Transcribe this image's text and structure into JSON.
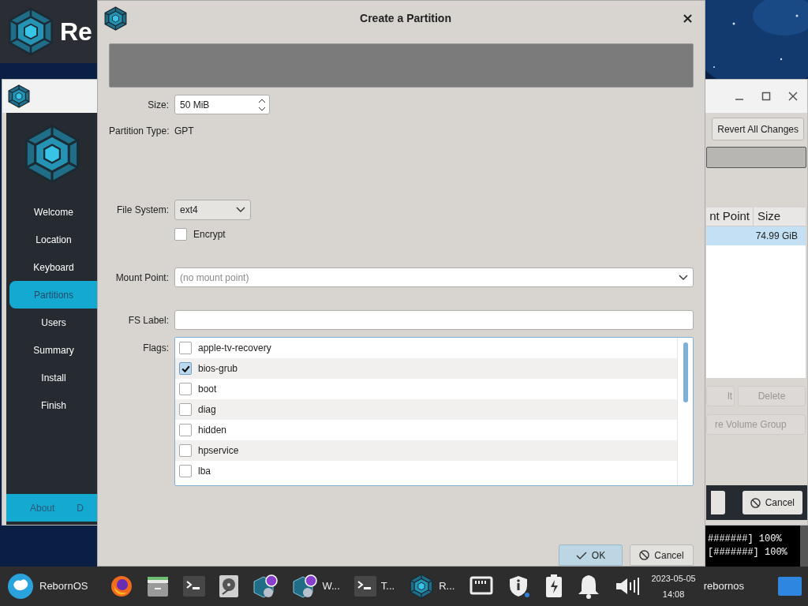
{
  "banner": {
    "text": "Re"
  },
  "installer": {
    "sidebar": [
      {
        "label": "Welcome",
        "selected": false
      },
      {
        "label": "Location",
        "selected": false
      },
      {
        "label": "Keyboard",
        "selected": false
      },
      {
        "label": "Partitions",
        "selected": true
      },
      {
        "label": "Users",
        "selected": false
      },
      {
        "label": "Summary",
        "selected": false
      },
      {
        "label": "Install",
        "selected": false
      },
      {
        "label": "Finish",
        "selected": false
      }
    ],
    "footer": [
      "About",
      "D"
    ],
    "revert_button": "Revert All Changes",
    "table": {
      "columns": [
        "nt Point",
        "Size"
      ],
      "rows": [
        {
          "size": "74.99 GiB",
          "selected": true
        }
      ]
    },
    "buttons": [
      {
        "label": "lt",
        "disabled": true
      },
      {
        "label": "Delete",
        "disabled": true
      }
    ],
    "volume_button": {
      "label": "re Volume Group",
      "disabled": true
    },
    "cancel_button": "Cancel"
  },
  "terminal": {
    "lines": [
      "#######] 100%",
      "[#######] 100%"
    ]
  },
  "dialog": {
    "title": "Create a Partition",
    "size": {
      "label": "Size:",
      "value": "50 MiB"
    },
    "partition_type": {
      "label": "Partition Type:",
      "value": "GPT"
    },
    "file_system": {
      "label": "File System:",
      "value": "ext4"
    },
    "encrypt": {
      "label": "Encrypt",
      "checked": false
    },
    "mount_point": {
      "label": "Mount Point:",
      "placeholder": "(no mount point)"
    },
    "fs_label": {
      "label": "FS Label:"
    },
    "flags": {
      "label": "Flags:",
      "items": [
        {
          "name": "apple-tv-recovery",
          "checked": false
        },
        {
          "name": "bios-grub",
          "checked": true
        },
        {
          "name": "boot",
          "checked": false
        },
        {
          "name": "diag",
          "checked": false
        },
        {
          "name": "hidden",
          "checked": false
        },
        {
          "name": "hpservice",
          "checked": false
        },
        {
          "name": "lba",
          "checked": false
        }
      ]
    },
    "ok_button": "OK",
    "cancel_button": "Cancel"
  },
  "taskbar": {
    "start": "RebornOS",
    "items": [
      {
        "kind": "browser"
      },
      {
        "kind": "files"
      },
      {
        "kind": "terminal"
      },
      {
        "kind": "disk"
      },
      {
        "kind": "installer"
      },
      {
        "kind": "installer",
        "label": "W..."
      },
      {
        "kind": "terminal",
        "label": "T..."
      },
      {
        "kind": "logo",
        "label": "R..."
      }
    ],
    "tray": [
      {
        "kind": "network"
      },
      {
        "kind": "shield"
      },
      {
        "kind": "battery"
      },
      {
        "kind": "bell"
      },
      {
        "kind": "volume"
      }
    ],
    "date": "2023-05-05",
    "time": "14:08",
    "user": "rebornos"
  }
}
